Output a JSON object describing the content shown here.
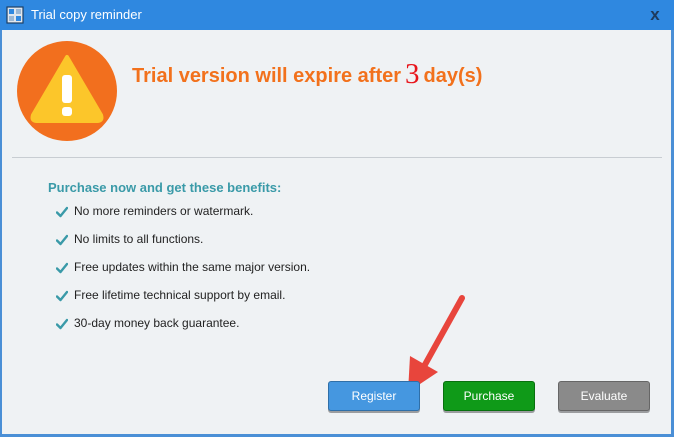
{
  "window": {
    "title": "Trial copy reminder",
    "close_glyph": "x",
    "icon": "app-icon"
  },
  "header": {
    "heading_prefix": "Trial version will expire after",
    "days": "3",
    "heading_suffix": "day(s)",
    "icon": "warning-icon",
    "colors": {
      "heading": "#f2711c",
      "days": "#e8151b",
      "warning_circle": "#f26f1e",
      "warning_triangle": "#fcc62a"
    }
  },
  "benefits": {
    "title": "Purchase now and get these benefits:",
    "items": [
      "No more reminders or watermark.",
      "No limits to all functions.",
      "Free updates within the same major version.",
      "Free lifetime technical support by email.",
      "30-day money back guarantee."
    ]
  },
  "buttons": {
    "register": "Register",
    "purchase": "Purchase",
    "evaluate": "Evaluate"
  }
}
